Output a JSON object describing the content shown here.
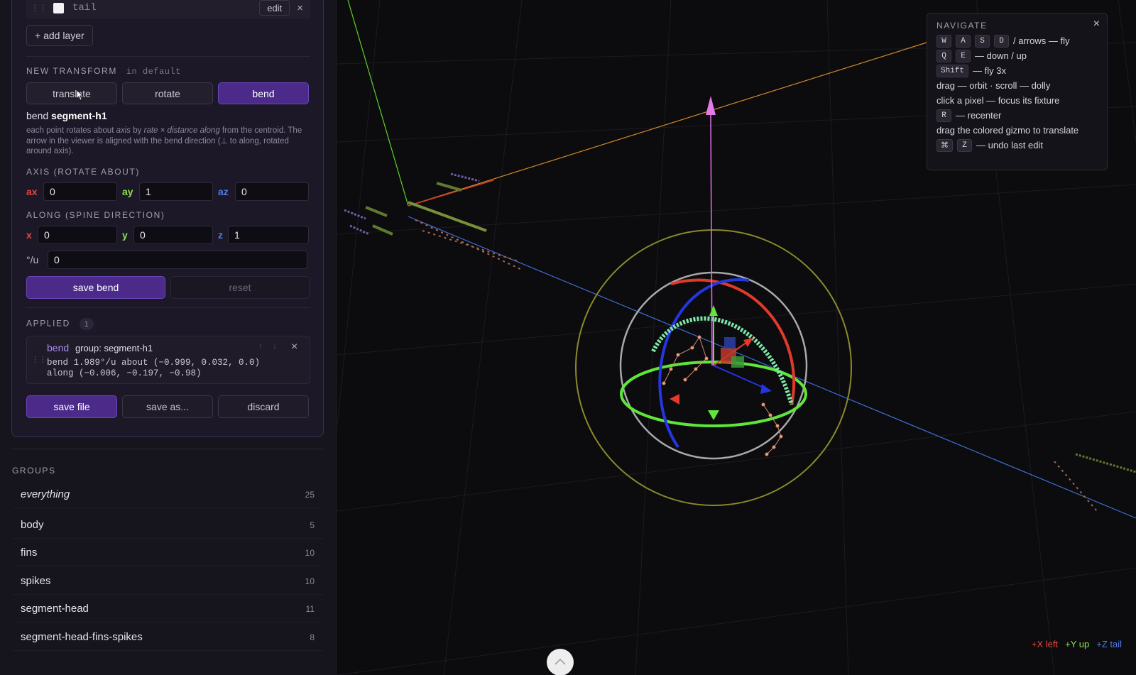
{
  "layer": {
    "name": "tail",
    "edit_label": "edit",
    "close_label": "×",
    "grip": "⋮⋮"
  },
  "add_layer_label": "+ add layer",
  "new_transform": {
    "label": "NEW TRANSFORM",
    "sub": "in default",
    "modes": [
      "translate",
      "rotate",
      "bend"
    ],
    "active_mode": "bend",
    "title_prefix": "bend",
    "title_target": "segment-h1",
    "desc_1": "each point rotates about",
    "desc_axis": "axis",
    "desc_2": "by",
    "desc_rate": "rate × distance along",
    "desc_3": "from the centroid. The arrow in the viewer is aligned with the bend direction (⊥ to along, rotated around axis).",
    "axis_label": "AXIS (ROTATE ABOUT)",
    "axis": {
      "ax_label": "ax",
      "ax": "0",
      "ay_label": "ay",
      "ay": "1",
      "az_label": "az",
      "az": "0"
    },
    "along_label": "ALONG (SPINE DIRECTION)",
    "along": {
      "x_label": "x",
      "x": "0",
      "y_label": "y",
      "y": "0",
      "z_label": "z",
      "z": "1"
    },
    "rate_label": "°/u",
    "rate": "0",
    "save_label": "save bend",
    "reset_label": "reset"
  },
  "applied": {
    "label": "APPLIED",
    "count": "1",
    "item": {
      "kind": "bend",
      "group": "group: segment-h1",
      "line1": "bend 1.989°/u about (−0.999, 0.032, 0.0)",
      "line2": "along (−0.006, −0.197, −0.98)",
      "up": "↑",
      "down": "↓",
      "close": "×",
      "grip": "⋮⋮"
    }
  },
  "file_actions": {
    "save_file": "save file",
    "save_as": "save as...",
    "discard": "discard"
  },
  "groups": {
    "label": "GROUPS",
    "items": [
      {
        "name": "everything",
        "count": "25"
      },
      {
        "name": "body",
        "count": "5"
      },
      {
        "name": "fins",
        "count": "10"
      },
      {
        "name": "spikes",
        "count": "10"
      },
      {
        "name": "segment-head",
        "count": "11"
      },
      {
        "name": "segment-head-fins-spikes",
        "count": "8"
      }
    ]
  },
  "navigate": {
    "title": "NAVIGATE",
    "close": "×",
    "keys_wasd": [
      "W",
      "A",
      "S",
      "D"
    ],
    "fly_text": "/ arrows — fly",
    "keys_qe": [
      "Q",
      "E"
    ],
    "updown_text": "— down / up",
    "key_shift": "Shift",
    "shift_text": "— fly 3x",
    "orbit_text": "drag — orbit · scroll — dolly",
    "focus_text": "click a pixel — focus its fixture",
    "key_r": "R",
    "recenter_text": "— recenter",
    "gizmo_text": "drag the colored gizmo to translate",
    "key_cmd": "⌘",
    "key_z": "Z",
    "undo_text": "— undo last edit"
  },
  "axis_legend": {
    "x": "+X left",
    "y": "+Y up",
    "z": "+Z tail"
  },
  "colors": {
    "accent": "#4b2a8a",
    "x_axis": "#e5473b",
    "y_axis": "#8ee04a",
    "z_axis": "#4f7de8"
  }
}
